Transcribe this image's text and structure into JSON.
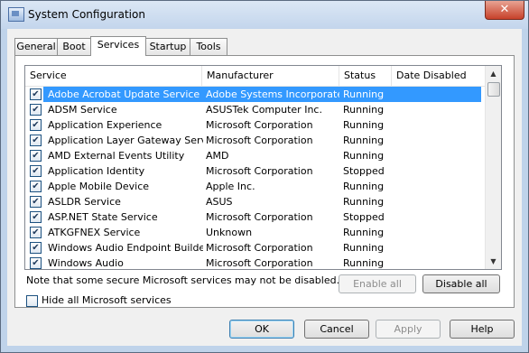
{
  "window": {
    "title": "System Configuration",
    "close_glyph": "✕",
    "app_icon": "msconfig-icon"
  },
  "tabs": [
    {
      "label": "General",
      "active": false
    },
    {
      "label": "Boot",
      "active": false
    },
    {
      "label": "Services",
      "active": true
    },
    {
      "label": "Startup",
      "active": false
    },
    {
      "label": "Tools",
      "active": false
    }
  ],
  "services_list": {
    "columns": [
      "Service",
      "Manufacturer",
      "Status",
      "Date Disabled"
    ],
    "rows": [
      {
        "checked": true,
        "service": "Adobe Acrobat Update Service",
        "manufacturer": "Adobe Systems Incorporated",
        "status": "Running",
        "date_disabled": "",
        "selected": true
      },
      {
        "checked": true,
        "service": "ADSM Service",
        "manufacturer": "ASUSTek Computer Inc.",
        "status": "Running",
        "date_disabled": ""
      },
      {
        "checked": true,
        "service": "Application Experience",
        "manufacturer": "Microsoft Corporation",
        "status": "Running",
        "date_disabled": ""
      },
      {
        "checked": true,
        "service": "Application Layer Gateway Service",
        "manufacturer": "Microsoft Corporation",
        "status": "Running",
        "date_disabled": ""
      },
      {
        "checked": true,
        "service": "AMD External Events Utility",
        "manufacturer": "AMD",
        "status": "Running",
        "date_disabled": ""
      },
      {
        "checked": true,
        "service": "Application Identity",
        "manufacturer": "Microsoft Corporation",
        "status": "Stopped",
        "date_disabled": ""
      },
      {
        "checked": true,
        "service": "Apple Mobile Device",
        "manufacturer": "Apple Inc.",
        "status": "Running",
        "date_disabled": ""
      },
      {
        "checked": true,
        "service": "ASLDR Service",
        "manufacturer": "ASUS",
        "status": "Running",
        "date_disabled": ""
      },
      {
        "checked": true,
        "service": "ASP.NET State Service",
        "manufacturer": "Microsoft Corporation",
        "status": "Stopped",
        "date_disabled": ""
      },
      {
        "checked": true,
        "service": "ATKGFNEX Service",
        "manufacturer": "Unknown",
        "status": "Running",
        "date_disabled": ""
      },
      {
        "checked": true,
        "service": "Windows Audio Endpoint Builder",
        "manufacturer": "Microsoft Corporation",
        "status": "Running",
        "date_disabled": ""
      },
      {
        "checked": true,
        "service": "Windows Audio",
        "manufacturer": "Microsoft Corporation",
        "status": "Running",
        "date_disabled": ""
      }
    ],
    "scroll_up_glyph": "▲",
    "scroll_down_glyph": "▼"
  },
  "note": "Note that some secure Microsoft services may not be disabled.",
  "enable_all": "Enable all",
  "disable_all": "Disable all",
  "hide_ms_services": {
    "label": "Hide all Microsoft services",
    "checked": false
  },
  "footer": {
    "ok": "OK",
    "cancel": "Cancel",
    "apply": "Apply",
    "help": "Help"
  },
  "colors": {
    "selection": "#3399ff",
    "titlebar": "#c3d5ec",
    "close_button": "#c7412a"
  }
}
